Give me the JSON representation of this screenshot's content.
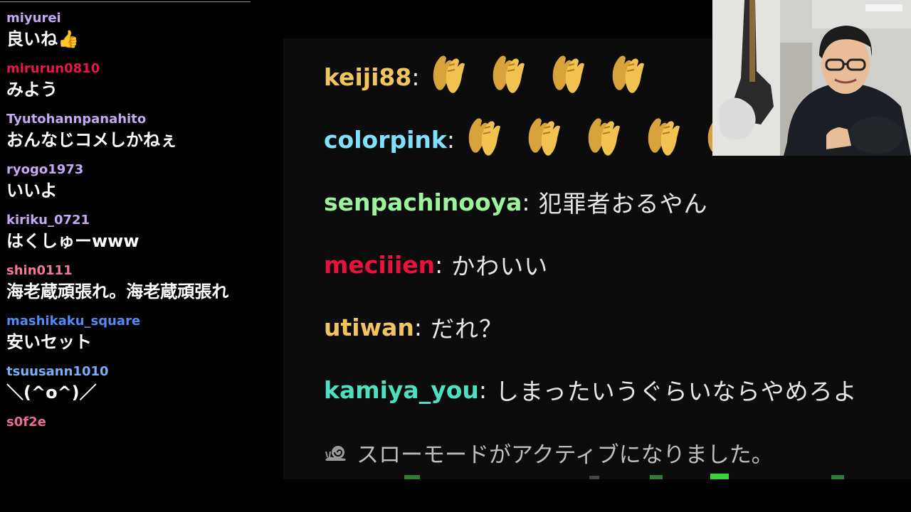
{
  "left_chat": {
    "messages": [
      {
        "user": "miyurei",
        "text": "良いね👍",
        "color": "#c4a8f2"
      },
      {
        "user": "mirurun0810",
        "text": "みよう",
        "color": "#e8154f"
      },
      {
        "user": "Tyutohannpanahito",
        "text": "おんなじコメしかねぇ",
        "color": "#c4a8f2"
      },
      {
        "user": "ryogo1973",
        "text": "いいよ",
        "color": "#c4a8f2"
      },
      {
        "user": "kiriku_0721",
        "text": "はくしゅーwww",
        "color": "#c4a8f2"
      },
      {
        "user": "shin0111",
        "text": "海老蔵頑張れ。海老蔵頑張れ",
        "color": "#ee7a95"
      },
      {
        "user": "mashikaku_square",
        "text": "安いセット",
        "color": "#4f8df2"
      },
      {
        "user": "tsuusann1010",
        "text": "＼(^o^)／",
        "color": "#77aef5"
      },
      {
        "user": "s0f2e",
        "text": "",
        "color": "#e86d8f"
      }
    ]
  },
  "zoom_chat": {
    "messages": [
      {
        "user": "keiji88",
        "text": "",
        "emote_count": 4,
        "color": "#f2c45e"
      },
      {
        "user": "colorpink",
        "text": "",
        "emote_count": 5,
        "color": "#7fe0ff"
      },
      {
        "user": "senpachinooya",
        "text": "犯罪者おるやん",
        "emote_count": 0,
        "color": "#9df29d"
      },
      {
        "user": "meciiien",
        "text": "かわいい",
        "emote_count": 0,
        "color": "#e8123f"
      },
      {
        "user": "utiwan",
        "text": "だれ？",
        "emote_count": 0,
        "color": "#f2c45e"
      },
      {
        "user": "kamiya_you",
        "text": "しまったいうぐらいならやめろよ",
        "emote_count": 0,
        "color": "#4de0c0"
      }
    ],
    "system_message": "スローモードがアクティブになりました。",
    "emote_icon": "clapping-hands-icon",
    "system_icon": "snail-icon"
  },
  "webcam": {
    "icon": "webcam-feed"
  }
}
